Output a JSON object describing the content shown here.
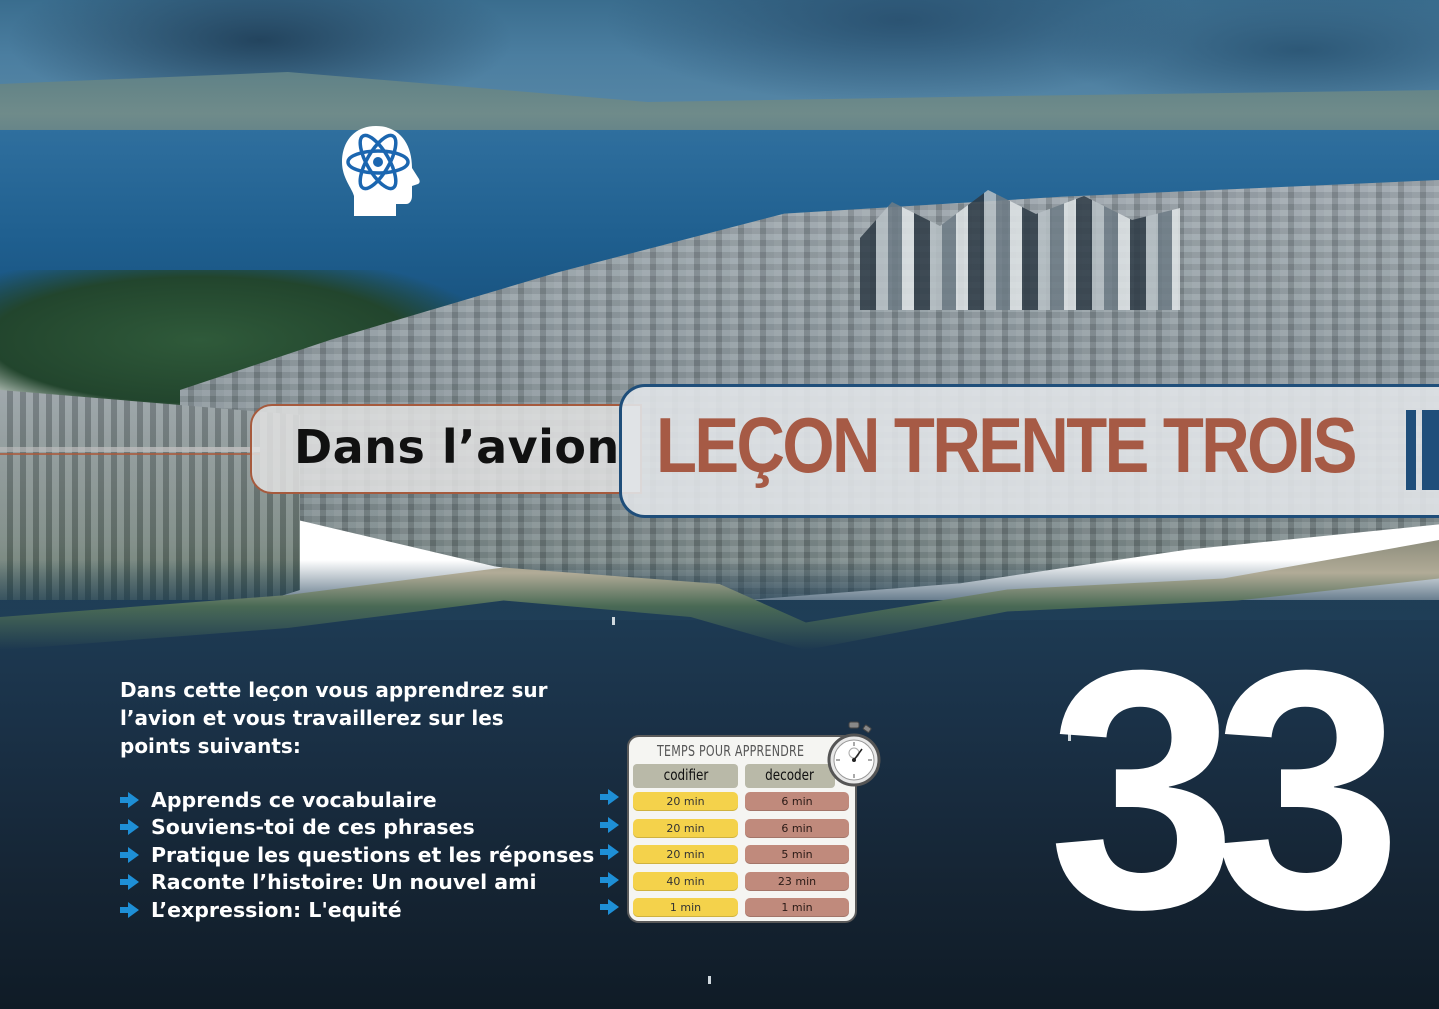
{
  "lesson": {
    "subtitle": "Dans l’avion",
    "title": "LEÇON TRENTE TROIS",
    "number": "33"
  },
  "intro": "Dans cette leçon vous apprendrez sur l’avion et vous travaillerez sur les points suivants:",
  "bullets": [
    "Apprends ce vocabulaire",
    "Souviens-toi de ces phrases",
    "Pratique les questions et les réponses",
    "Raconte l’histoire: Un nouvel ami",
    "L’expression: L'equité"
  ],
  "time_table": {
    "title": "TEMPS POUR APPRENDRE",
    "columns": [
      "codifier",
      "decoder"
    ],
    "rows": [
      [
        "20 min",
        "6 min"
      ],
      [
        "20 min",
        "6 min"
      ],
      [
        "20 min",
        "5 min"
      ],
      [
        "40 min",
        "23 min"
      ],
      [
        "1 min",
        "1 min"
      ]
    ]
  },
  "colors": {
    "accent_blue": "#1f4e7a",
    "title_rust": "#a65a45",
    "arrow_blue": "#1e8fd6",
    "cell_yellow": "#f4d24b",
    "cell_rose": "#c08a7c"
  },
  "icons": {
    "logo": "brain-atom-icon",
    "bullet": "arrow-right-icon",
    "timer": "stopwatch-icon"
  }
}
